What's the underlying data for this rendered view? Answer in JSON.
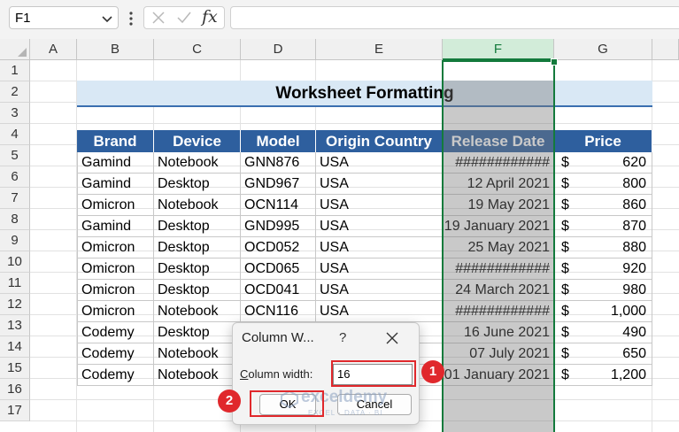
{
  "formula_bar": {
    "name_box": "F1",
    "fx_label": "fx",
    "formula": ""
  },
  "columns": [
    "A",
    "B",
    "C",
    "D",
    "E",
    "F",
    "G"
  ],
  "selected_column": "F",
  "rows": [
    "1",
    "2",
    "3",
    "4",
    "5",
    "6",
    "7",
    "8",
    "9",
    "10",
    "11",
    "12",
    "13",
    "14",
    "15",
    "16",
    "17"
  ],
  "sheet": {
    "title": "Worksheet Formatting",
    "headers": [
      "Brand",
      "Device",
      "Model",
      "Origin Country",
      "Release Date",
      "Price"
    ],
    "data": [
      [
        "Gamind",
        "Notebook",
        "GNN876",
        "USA",
        "############",
        "$",
        "620"
      ],
      [
        "Gamind",
        "Desktop",
        "GND967",
        "USA",
        "12 April 2021",
        "$",
        "800"
      ],
      [
        "Omicron",
        "Notebook",
        "OCN114",
        "USA",
        "19 May 2021",
        "$",
        "860"
      ],
      [
        "Gamind",
        "Desktop",
        "GND995",
        "USA",
        "19 January 2021",
        "$",
        "870"
      ],
      [
        "Omicron",
        "Desktop",
        "OCD052",
        "USA",
        "25 May 2021",
        "$",
        "880"
      ],
      [
        "Omicron",
        "Desktop",
        "OCD065",
        "USA",
        "############",
        "$",
        "920"
      ],
      [
        "Omicron",
        "Desktop",
        "OCD041",
        "USA",
        "24 March 2021",
        "$",
        "980"
      ],
      [
        "Omicron",
        "Notebook",
        "OCN116",
        "USA",
        "############",
        "$",
        "1,000"
      ],
      [
        "Codemy",
        "Desktop",
        "",
        "",
        "16 June 2021",
        "$",
        "490"
      ],
      [
        "Codemy",
        "Notebook",
        "",
        "",
        "07 July 2021",
        "$",
        "650"
      ],
      [
        "Codemy",
        "Notebook",
        "",
        "",
        "01 January 2021",
        "$",
        "1,200"
      ]
    ]
  },
  "dialog": {
    "title": "Column W...",
    "help": "?",
    "label_accel": "C",
    "label_rest": "olumn width:",
    "value": "16",
    "ok": "OK",
    "cancel": "Cancel"
  },
  "callouts": [
    "1",
    "2"
  ],
  "watermark": {
    "name": "exceldemy",
    "tagline": "EXCEL · DATA · BI"
  },
  "colors": {
    "header_fill": "#2e5f9e",
    "title_fill": "#d9e8f5",
    "selection_green": "#137a3c",
    "callout_red": "#e0282c"
  }
}
